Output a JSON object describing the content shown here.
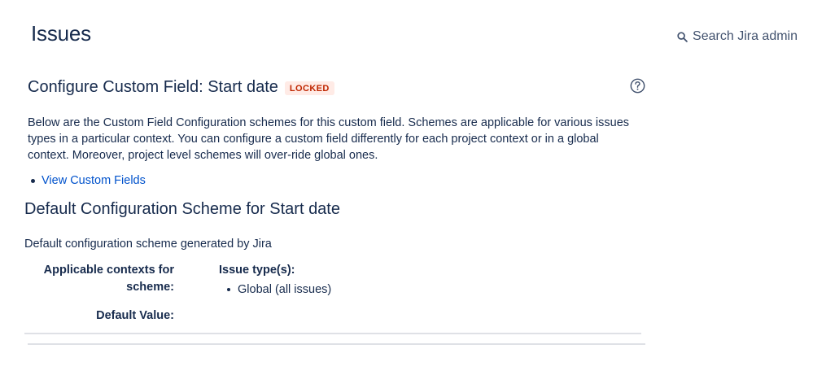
{
  "header": {
    "title": "Issues",
    "search_label": "Search Jira admin",
    "search_icon": "search-icon"
  },
  "custom_field": {
    "title": "Configure Custom Field: Start date",
    "status_badge": "LOCKED",
    "help_icon": "help-icon",
    "description": "Below are the Custom Field Configuration schemes for this custom field. Schemes are applicable for various issues types in a particular context. You can configure a custom field differently for each project context or in a global context. Moreover, project level schemes will over-ride global ones.",
    "links": [
      {
        "label": "View Custom Fields"
      }
    ]
  },
  "scheme": {
    "title": "Default Configuration Scheme for Start date",
    "description": "Default configuration scheme generated by Jira",
    "contexts_label_line1": "Applicable contexts for",
    "contexts_label_line2": "scheme:",
    "issue_types_heading": "Issue type(s):",
    "issue_types": [
      "Global (all issues)"
    ],
    "default_value_label": "Default Value:"
  },
  "colors": {
    "text": "#172b4d",
    "link": "#0052cc",
    "locked_bg": "#ffebe6",
    "locked_text": "#bf2600",
    "divider": "#dfe1e6"
  }
}
